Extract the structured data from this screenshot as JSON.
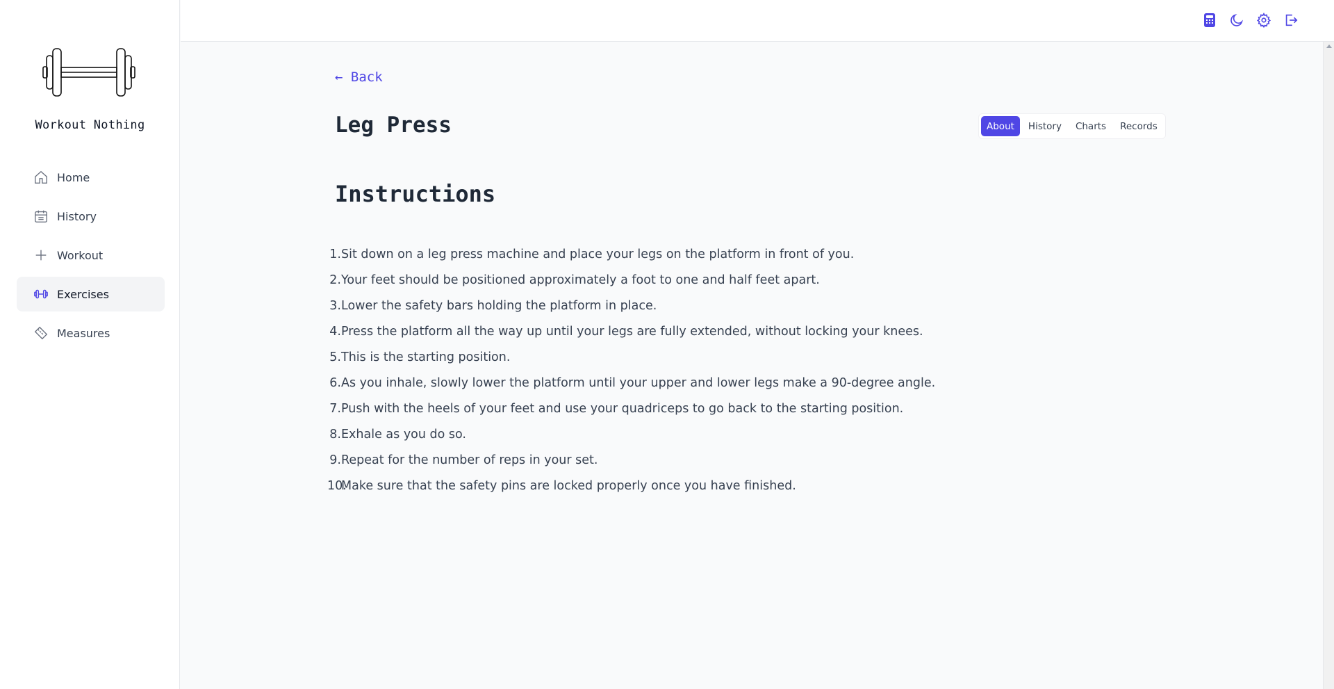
{
  "app": {
    "name": "Workout Nothing"
  },
  "sidebar": {
    "items": [
      {
        "label": "Home",
        "icon": "home-icon",
        "active": false
      },
      {
        "label": "History",
        "icon": "calendar-icon",
        "active": false
      },
      {
        "label": "Workout",
        "icon": "plus-icon",
        "active": false
      },
      {
        "label": "Exercises",
        "icon": "dumbbell-icon",
        "active": true
      },
      {
        "label": "Measures",
        "icon": "ruler-icon",
        "active": false
      }
    ]
  },
  "topbar": {
    "icons": [
      "calculator-icon",
      "moon-icon",
      "gear-icon",
      "logout-icon"
    ],
    "accent": "#4f46e5"
  },
  "main": {
    "back_label": "← Back",
    "title": "Leg Press",
    "tabs": [
      {
        "label": "About",
        "active": true
      },
      {
        "label": "History",
        "active": false
      },
      {
        "label": "Charts",
        "active": false
      },
      {
        "label": "Records",
        "active": false
      }
    ],
    "section_title": "Instructions",
    "instructions": [
      {
        "num": "1.",
        "text": "Sit down on a leg press machine and place your legs on the platform in front of you."
      },
      {
        "num": "2.",
        "text": "Your feet should be positioned approximately a foot to one and half feet apart."
      },
      {
        "num": "3.",
        "text": "Lower the safety bars holding the platform in place."
      },
      {
        "num": "4.",
        "text": "Press the platform all the way up until your legs are fully extended, without locking your knees."
      },
      {
        "num": "5.",
        "text": "This is the starting position."
      },
      {
        "num": "6.",
        "text": "As you inhale, slowly lower the platform until your upper and lower legs make a 90-degree angle."
      },
      {
        "num": "7.",
        "text": "Push with the heels of your feet and use your quadriceps to go back to the starting position."
      },
      {
        "num": "8.",
        "text": "Exhale as you do so."
      },
      {
        "num": "9.",
        "text": "Repeat for the number of reps in your set."
      },
      {
        "num": "10.",
        "text": "Make sure that the safety pins are locked properly once you have finished."
      }
    ]
  }
}
